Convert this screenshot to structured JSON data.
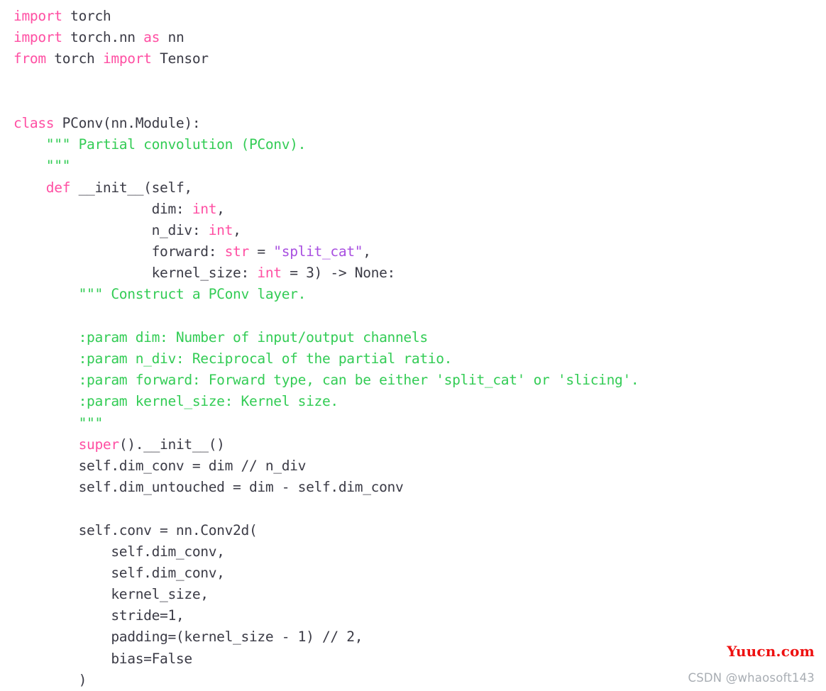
{
  "editor": {
    "language": "python",
    "background_color": "#ffffff",
    "colors": {
      "plain": "#3b3b46",
      "keyword": "#ff4fa3",
      "type": "#ff4fa3",
      "builtin": "#ff4fa3",
      "string": "#a84fe0",
      "docstring": "#33cc55"
    },
    "lines": [
      {
        "n": 1,
        "tokens": [
          {
            "t": "import",
            "c": "kw"
          },
          {
            "t": " torch",
            "c": "plain"
          }
        ]
      },
      {
        "n": 2,
        "tokens": [
          {
            "t": "import",
            "c": "kw"
          },
          {
            "t": " torch.nn ",
            "c": "plain"
          },
          {
            "t": "as",
            "c": "kw"
          },
          {
            "t": " nn",
            "c": "plain"
          }
        ]
      },
      {
        "n": 3,
        "tokens": [
          {
            "t": "from",
            "c": "kw"
          },
          {
            "t": " torch ",
            "c": "plain"
          },
          {
            "t": "import",
            "c": "kw"
          },
          {
            "t": " Tensor",
            "c": "plain"
          }
        ]
      },
      {
        "n": 4,
        "tokens": []
      },
      {
        "n": 5,
        "tokens": []
      },
      {
        "n": 6,
        "tokens": [
          {
            "t": "class",
            "c": "kw"
          },
          {
            "t": " PConv(nn.Module):",
            "c": "plain"
          }
        ]
      },
      {
        "n": 7,
        "tokens": [
          {
            "t": "    \"\"\" Partial convolution (PConv).",
            "c": "doc"
          }
        ]
      },
      {
        "n": 8,
        "tokens": [
          {
            "t": "    \"\"\"",
            "c": "doc"
          }
        ]
      },
      {
        "n": 9,
        "tokens": [
          {
            "t": "    ",
            "c": "plain"
          },
          {
            "t": "def",
            "c": "kw"
          },
          {
            "t": " __init__(self,",
            "c": "plain"
          }
        ]
      },
      {
        "n": 10,
        "tokens": [
          {
            "t": "                 dim: ",
            "c": "plain"
          },
          {
            "t": "int",
            "c": "type"
          },
          {
            "t": ",",
            "c": "plain"
          }
        ]
      },
      {
        "n": 11,
        "tokens": [
          {
            "t": "                 n_div: ",
            "c": "plain"
          },
          {
            "t": "int",
            "c": "type"
          },
          {
            "t": ",",
            "c": "plain"
          }
        ]
      },
      {
        "n": 12,
        "tokens": [
          {
            "t": "                 forward: ",
            "c": "plain"
          },
          {
            "t": "str",
            "c": "type"
          },
          {
            "t": " = ",
            "c": "plain"
          },
          {
            "t": "\"split_cat\"",
            "c": "str"
          },
          {
            "t": ",",
            "c": "plain"
          }
        ]
      },
      {
        "n": 13,
        "tokens": [
          {
            "t": "                 kernel_size: ",
            "c": "plain"
          },
          {
            "t": "int",
            "c": "type"
          },
          {
            "t": " = 3) -> None:",
            "c": "plain"
          }
        ]
      },
      {
        "n": 14,
        "tokens": [
          {
            "t": "        \"\"\" Construct a PConv layer.",
            "c": "doc"
          }
        ]
      },
      {
        "n": 15,
        "tokens": []
      },
      {
        "n": 16,
        "tokens": [
          {
            "t": "        :param dim: Number of input/output channels",
            "c": "doc"
          }
        ]
      },
      {
        "n": 17,
        "tokens": [
          {
            "t": "        :param n_div: Reciprocal of the partial ratio.",
            "c": "doc"
          }
        ]
      },
      {
        "n": 18,
        "tokens": [
          {
            "t": "        :param forward: Forward type, can be either 'split_cat' or 'slicing'.",
            "c": "doc"
          }
        ]
      },
      {
        "n": 19,
        "tokens": [
          {
            "t": "        :param kernel_size: Kernel size.",
            "c": "doc"
          }
        ]
      },
      {
        "n": 20,
        "tokens": [
          {
            "t": "        \"\"\"",
            "c": "doc"
          }
        ]
      },
      {
        "n": 21,
        "tokens": [
          {
            "t": "        ",
            "c": "plain"
          },
          {
            "t": "super",
            "c": "builtin"
          },
          {
            "t": "().__init__()",
            "c": "plain"
          }
        ]
      },
      {
        "n": 22,
        "tokens": [
          {
            "t": "        self.dim_conv = dim // n_div",
            "c": "plain"
          }
        ]
      },
      {
        "n": 23,
        "tokens": [
          {
            "t": "        self.dim_untouched = dim - self.dim_conv",
            "c": "plain"
          }
        ]
      },
      {
        "n": 24,
        "tokens": []
      },
      {
        "n": 25,
        "tokens": [
          {
            "t": "        self.conv = nn.Conv2d(",
            "c": "plain"
          }
        ]
      },
      {
        "n": 26,
        "tokens": [
          {
            "t": "            self.dim_conv,",
            "c": "plain"
          }
        ]
      },
      {
        "n": 27,
        "tokens": [
          {
            "t": "            self.dim_conv,",
            "c": "plain"
          }
        ]
      },
      {
        "n": 28,
        "tokens": [
          {
            "t": "            kernel_size,",
            "c": "plain"
          }
        ]
      },
      {
        "n": 29,
        "tokens": [
          {
            "t": "            stride=1,",
            "c": "plain"
          }
        ]
      },
      {
        "n": 30,
        "tokens": [
          {
            "t": "            padding=(kernel_size - 1) // 2,",
            "c": "plain"
          }
        ]
      },
      {
        "n": 31,
        "tokens": [
          {
            "t": "            bias=False",
            "c": "plain"
          }
        ]
      },
      {
        "n": 32,
        "tokens": [
          {
            "t": "        )",
            "c": "plain"
          }
        ]
      }
    ]
  },
  "watermarks": {
    "primary": "Yuucn.com",
    "primary_color": "#ee1111",
    "secondary": "CSDN @whaosoft143",
    "secondary_color": "#a8adb3"
  }
}
